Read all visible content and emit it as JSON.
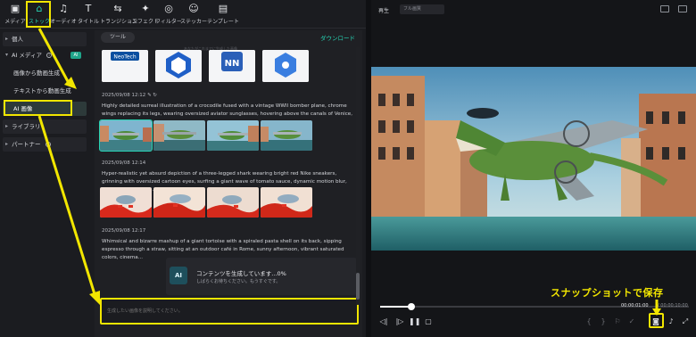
{
  "toolbar": {
    "items": [
      {
        "label": "メディア",
        "icon": "media-icon"
      },
      {
        "label": "ストック",
        "icon": "stock-icon"
      },
      {
        "label": "オーディオ",
        "icon": "audio-icon"
      },
      {
        "label": "タイトル",
        "icon": "title-icon"
      },
      {
        "label": "トランジション",
        "icon": "transition-icon"
      },
      {
        "label": "エフェクト",
        "icon": "effect-icon"
      },
      {
        "label": "フィルター",
        "icon": "filter-icon"
      },
      {
        "label": "ステッカー",
        "icon": "sticker-icon"
      },
      {
        "label": "テンプレート",
        "icon": "template-icon"
      }
    ]
  },
  "sidebar": {
    "personal": "個人",
    "ai_media": "AI メディア",
    "ai_badge": "AI",
    "image_to_video": "画像から動画生成",
    "text_to_video": "テキストから動画生成",
    "ai_image": "AI 画像",
    "library": "ライブラリ",
    "partner": "パートナー"
  },
  "content": {
    "tool_button": "ツール",
    "download_link": "ダウンロード",
    "hint": "あなたがこれまでに生成した画像",
    "logo_text_1": "NeoTech",
    "logo_text_3": "NN",
    "groups": [
      {
        "date": "2025/09/08 12:12",
        "text": "Highly detailed surreal illustration of a crocodile fused with a vintage WWII bomber plane, chrome wings replacing its legs, wearing oversized aviator sunglasses, hovering above the canals of Venice, vibrant colo..."
      },
      {
        "date": "2025/09/08 12:14",
        "text": "Hyper-realistic yet absurd depiction of a three-legged shark wearing bright red Nike sneakers, grinning with oversized cartoon eyes, surfing a giant wave of tomato sauce, dynamic motion blur, playful and chaotic, ..."
      },
      {
        "date": "2025/09/08 12:17",
        "text": "Whimsical and bizarre mashup of a giant tortoise with a spiraled pasta shell on its back, sipping espresso through a straw, sitting at an outdoor café in Rome, sunny afternoon, vibrant saturated colors, cinema..."
      }
    ],
    "generating_title": "コンテンツを生成しています...0%",
    "generating_sub": "しばらくお待ちください。もうすぐです。",
    "prompt_placeholder": "生成したい画像を説明してください。"
  },
  "player": {
    "play_label": "再生",
    "quality": "フル画質",
    "time_current": "00:00:01:00",
    "time_total": "/ 00:00:10:00",
    "progress": 0.1
  },
  "annotation": {
    "snapshot_label": "スナップショットで保存"
  },
  "colors": {
    "accent": "#27d3b3",
    "highlight": "#f2e600"
  }
}
